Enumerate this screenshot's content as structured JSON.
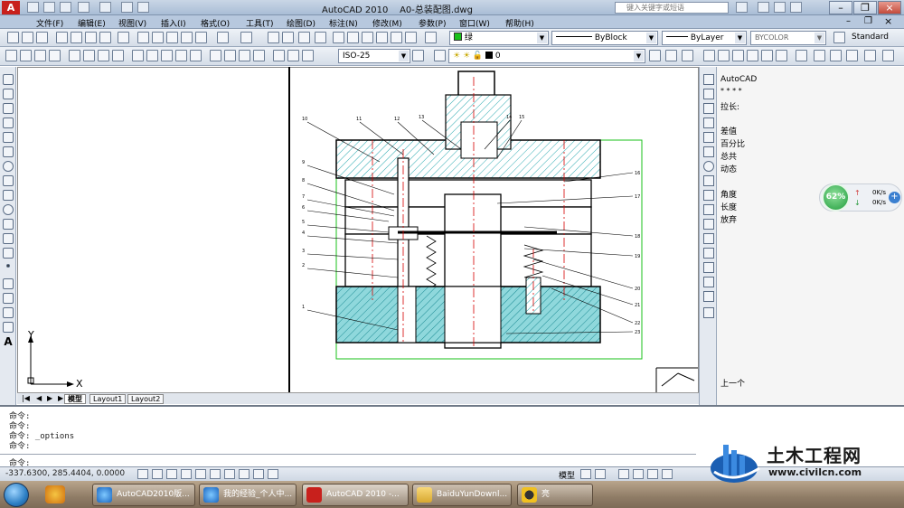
{
  "window": {
    "app_name": "AutoCAD 2010",
    "file_name": "A0-总装配图.dwg",
    "search_placeholder": "键入关键字或短语",
    "logo_letter": "A"
  },
  "menu": [
    "文件(F)",
    "编辑(E)",
    "视图(V)",
    "插入(I)",
    "格式(O)",
    "工具(T)",
    "绘图(D)",
    "标注(N)",
    "修改(M)",
    "参数(P)",
    "窗口(W)",
    "帮助(H)"
  ],
  "layer_toolbar": {
    "color_value": "绿",
    "linetype_value": "ByBlock",
    "lineweight_value": "ByLayer",
    "plotstyle_value": "BYCOLOR",
    "textstyle_value": "Standard"
  },
  "dim_toolbar": {
    "dimstyle_value": "ISO-25",
    "layer_value": "0"
  },
  "drawing": {
    "part_numbers": [
      "10",
      "11",
      "12",
      "13",
      "14",
      "15",
      "9",
      "8",
      "7",
      "6",
      "5",
      "4",
      "3",
      "2",
      "1",
      "16",
      "17",
      "18",
      "19",
      "20",
      "21",
      "22",
      "23"
    ],
    "axis_y": "Y",
    "axis_x": "X"
  },
  "layout_tabs": [
    "模型",
    "Layout1",
    "Layout2"
  ],
  "properties": {
    "title": "AutoCAD",
    "dots": "* * * *",
    "items_top": [
      "拉长:"
    ],
    "items": [
      "差值",
      "百分比",
      "总共",
      "动态"
    ],
    "items2": [
      "角度",
      "长度",
      "放弃"
    ],
    "bottom_item": "上一个"
  },
  "net_widget": {
    "percent": "62%",
    "up": "0K/s",
    "down": "0K/s"
  },
  "command_lines": [
    "命令:",
    "命令:",
    "命令: _options",
    "命令:"
  ],
  "command_prompt": "命令:",
  "status": {
    "coords": "-337.6300, 285.4404, 0.0000",
    "model_label": "模型"
  },
  "taskbar": {
    "tasks": [
      "AutoCAD2010版...",
      "我的经验_个人中...",
      "AutoCAD 2010 -...",
      "BaiduYunDownl...",
      "亮"
    ]
  },
  "watermark": {
    "text": "土木工程网",
    "url": "www.civilcn.com"
  },
  "colors": {
    "hatch_cyan": "#8fd8dc",
    "drawing_line": "#000000",
    "green_outline": "#19c219",
    "red_center": "#d40000"
  }
}
